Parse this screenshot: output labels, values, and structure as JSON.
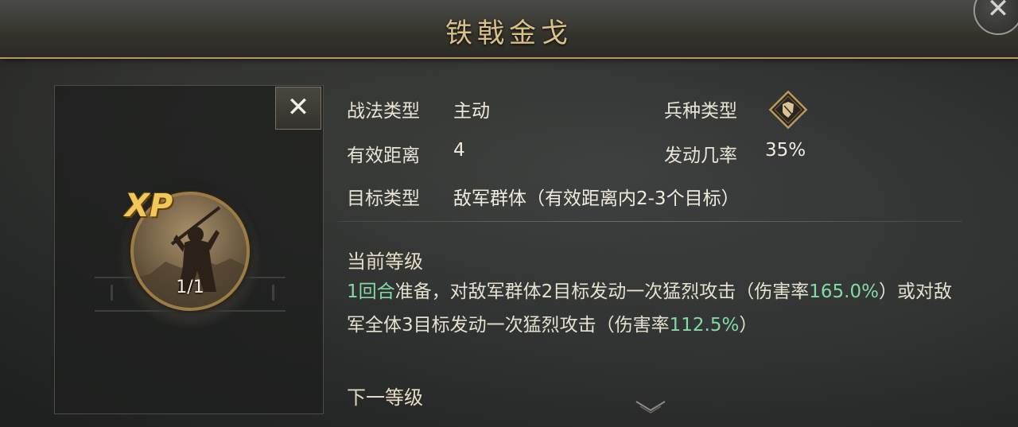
{
  "title": "铁戟金戈",
  "skill_icon": {
    "badge": "XP",
    "level": "1/1"
  },
  "info": {
    "type_label": "战法类型",
    "type_value": "主动",
    "troop_label": "兵种类型",
    "range_label": "有效距离",
    "range_value": "4",
    "rate_label": "发动几率",
    "rate_value": "35%",
    "target_label": "目标类型",
    "target_value": "敌军群体（有效距离内2-3个目标）"
  },
  "current_level": {
    "heading": "当前等级",
    "segments": [
      {
        "text": "1回合",
        "hl": true
      },
      {
        "text": "准备，对敌军群体2目标发动一次猛烈攻击（伤害率",
        "hl": false
      },
      {
        "text": "165.0%",
        "hl": true
      },
      {
        "text": "）或对敌军全体3目标发动一次猛烈攻击（伤害率",
        "hl": false
      },
      {
        "text": "112.5%",
        "hl": true
      },
      {
        "text": "）",
        "hl": false
      }
    ]
  },
  "next_level": {
    "heading": "下一等级"
  },
  "colors": {
    "highlight": "#84d9a4",
    "title_gold": "#d8c08a",
    "frame_gold": "#b39a5e"
  },
  "icons": {
    "top_close": "crossed-swords-close-icon",
    "panel_close": "close-icon",
    "troop": "shield-troop-icon",
    "scroll": "chevron-down-icon"
  }
}
